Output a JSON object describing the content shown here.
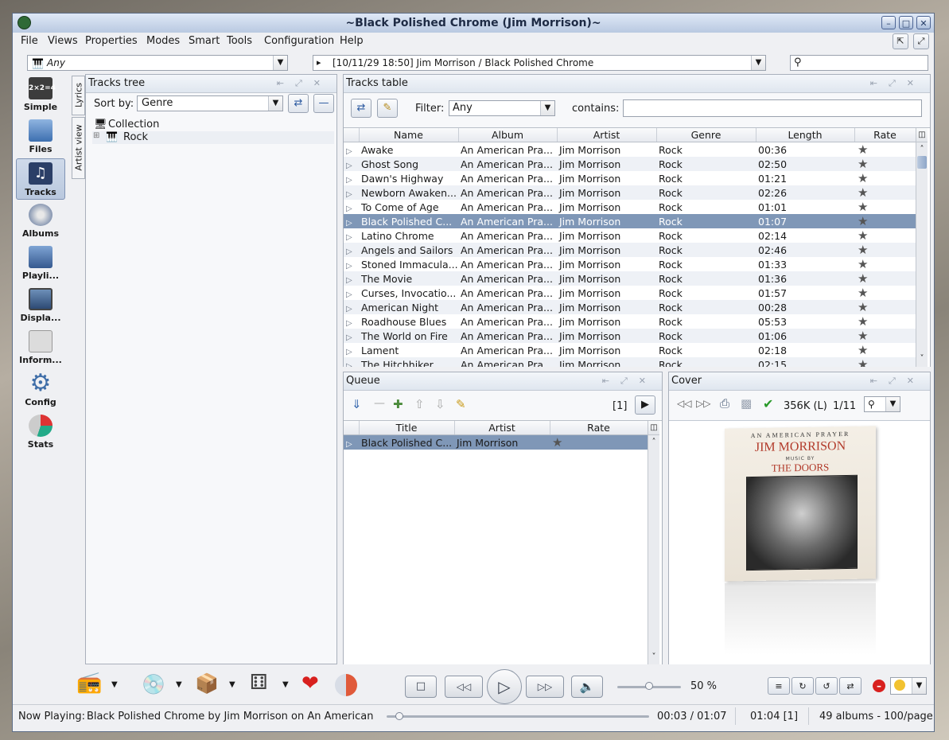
{
  "window": {
    "title": "~Black Polished Chrome (Jim Morrison)~"
  },
  "menu": [
    "File",
    "Views",
    "Properties",
    "Modes",
    "Smart",
    "Tools",
    "Configuration",
    "Help"
  ],
  "toolbar": {
    "filter_combo": "Any",
    "history_combo": "[10/11/29 18:50] Jim Morrison / Black Polished Chrome",
    "search_value": ""
  },
  "nav": [
    "Simple",
    "Files",
    "Tracks",
    "Albums",
    "Playli...",
    "Displa...",
    "Inform...",
    "Config",
    "Stats"
  ],
  "side_tabs": [
    "Lyrics",
    "Artist view"
  ],
  "tracks_tree": {
    "title": "Tracks tree",
    "sort_label": "Sort by:",
    "sort_value": "Genre",
    "items": [
      "Collection",
      "Rock"
    ]
  },
  "tracks_table": {
    "title": "Tracks table",
    "filter_label": "Filter:",
    "filter_value": "Any",
    "contains_label": "contains:",
    "contains_value": "",
    "columns": [
      "Name",
      "Album",
      "Artist",
      "Genre",
      "Length",
      "Rate"
    ],
    "rows": [
      {
        "name": "Awake",
        "album": "An American Pra...",
        "artist": "Jim Morrison",
        "genre": "Rock",
        "length": "00:36"
      },
      {
        "name": "Ghost Song",
        "album": "An American Pra...",
        "artist": "Jim Morrison",
        "genre": "Rock",
        "length": "02:50"
      },
      {
        "name": "Dawn's Highway",
        "album": "An American Pra...",
        "artist": "Jim Morrison",
        "genre": "Rock",
        "length": "01:21"
      },
      {
        "name": "Newborn Awaken...",
        "album": "An American Pra...",
        "artist": "Jim Morrison",
        "genre": "Rock",
        "length": "02:26"
      },
      {
        "name": "To Come of Age",
        "album": "An American Pra...",
        "artist": "Jim Morrison",
        "genre": "Rock",
        "length": "01:01"
      },
      {
        "name": "Black Polished C...",
        "album": "An American Pra...",
        "artist": "Jim Morrison",
        "genre": "Rock",
        "length": "01:07"
      },
      {
        "name": "Latino Chrome",
        "album": "An American Pra...",
        "artist": "Jim Morrison",
        "genre": "Rock",
        "length": "02:14"
      },
      {
        "name": "Angels and Sailors",
        "album": "An American Pra...",
        "artist": "Jim Morrison",
        "genre": "Rock",
        "length": "02:46"
      },
      {
        "name": "Stoned Immacula...",
        "album": "An American Pra...",
        "artist": "Jim Morrison",
        "genre": "Rock",
        "length": "01:33"
      },
      {
        "name": "The Movie",
        "album": "An American Pra...",
        "artist": "Jim Morrison",
        "genre": "Rock",
        "length": "01:36"
      },
      {
        "name": "Curses, Invocatio...",
        "album": "An American Pra...",
        "artist": "Jim Morrison",
        "genre": "Rock",
        "length": "01:57"
      },
      {
        "name": "American Night",
        "album": "An American Pra...",
        "artist": "Jim Morrison",
        "genre": "Rock",
        "length": "00:28"
      },
      {
        "name": "Roadhouse Blues",
        "album": "An American Pra...",
        "artist": "Jim Morrison",
        "genre": "Rock",
        "length": "05:53"
      },
      {
        "name": "The World on Fire",
        "album": "An American Pra...",
        "artist": "Jim Morrison",
        "genre": "Rock",
        "length": "01:06"
      },
      {
        "name": "Lament",
        "album": "An American Pra...",
        "artist": "Jim Morrison",
        "genre": "Rock",
        "length": "02:18"
      },
      {
        "name": "The Hitchhiker",
        "album": "An American Pra...",
        "artist": "Jim Morrison",
        "genre": "Rock",
        "length": "02:15"
      }
    ],
    "selected_index": 5
  },
  "queue": {
    "title": "Queue",
    "count": "[1]",
    "columns": [
      "Title",
      "Artist",
      "Rate"
    ],
    "rows": [
      {
        "title": "Black Polished C...",
        "artist": "Jim Morrison"
      }
    ]
  },
  "cover": {
    "title": "Cover",
    "size": "356K (L)",
    "index": "1/11",
    "art_line1": "AN AMERICAN PRAYER",
    "art_line2": "JIM MORRISON",
    "art_line3": "MUSIC BY",
    "art_line4": "THE DOORS"
  },
  "player": {
    "volume": "50 %",
    "volume_fraction": 0.5,
    "position_fraction": 0.047
  },
  "status": {
    "now_playing_label": "Now Playing:",
    "now_playing": "Black Polished Chrome by Jim Morrison on An American Pr",
    "time": "00:03 / 01:07",
    "queue_time": "01:04 [1]",
    "albums": "49 albums - 100/page"
  }
}
